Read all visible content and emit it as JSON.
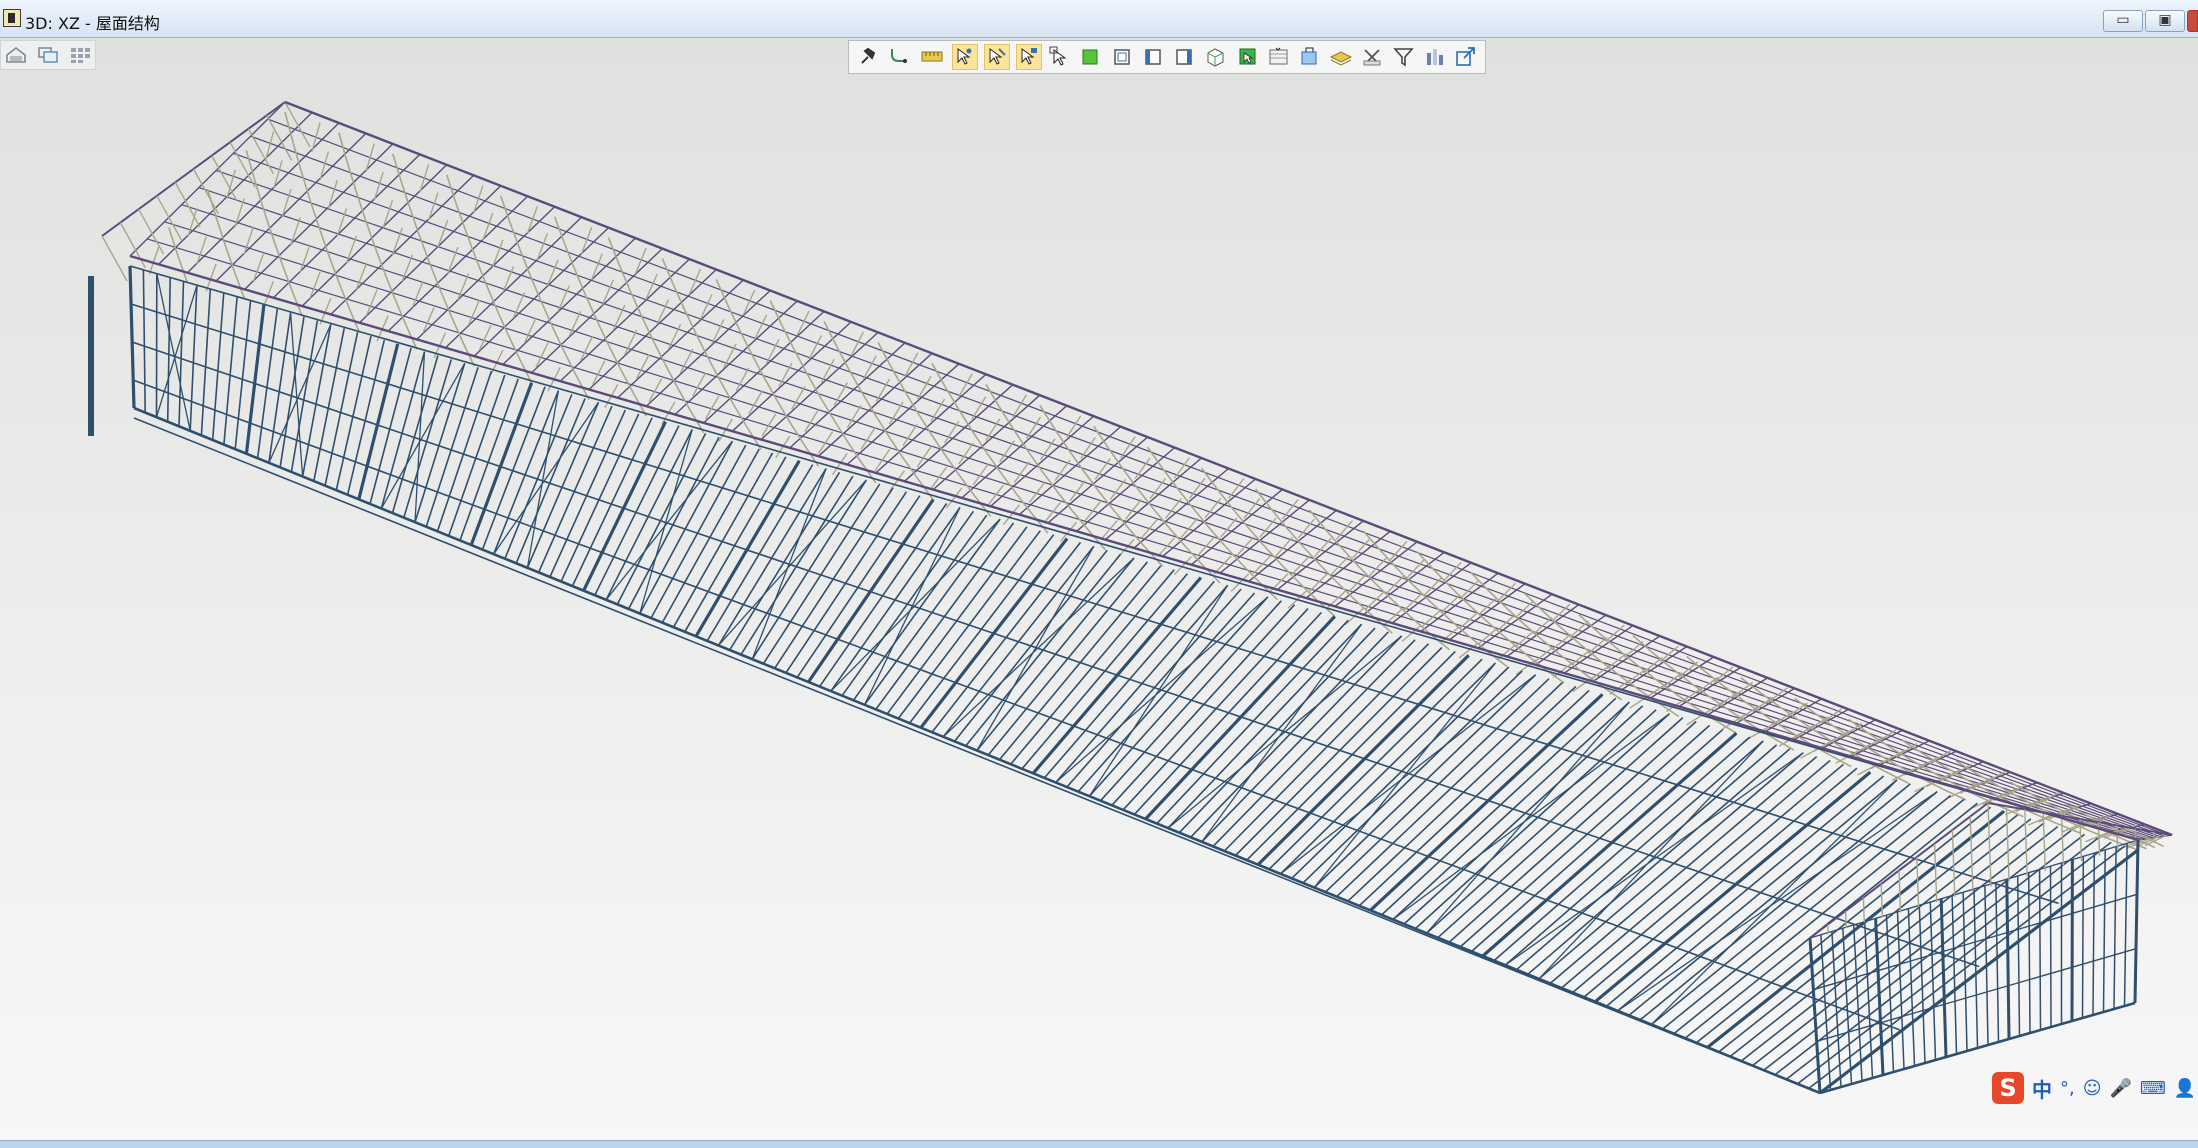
{
  "window": {
    "title": "3D: XZ - 屋面结构",
    "minimize_label": "▭",
    "maximize_label": "▣"
  },
  "view_controls": [
    {
      "name": "home-view-icon"
    },
    {
      "name": "window-stack-icon"
    },
    {
      "name": "grid-tiles-icon"
    }
  ],
  "toolbar": {
    "buttons": [
      {
        "name": "pin-icon",
        "active": false,
        "color": "#333333"
      },
      {
        "name": "snap-curve-icon",
        "active": false,
        "color": "#2e8b57"
      },
      {
        "name": "ruler-icon",
        "active": false,
        "color": "#e8c84a"
      },
      {
        "name": "select-point-icon",
        "active": true,
        "color": "#3a6fb0"
      },
      {
        "name": "select-edge-icon",
        "active": true,
        "color": "#3a6fb0"
      },
      {
        "name": "select-face-icon",
        "active": true,
        "color": "#3a6fb0"
      },
      {
        "name": "select-object-icon",
        "active": false,
        "color": "#333333"
      },
      {
        "name": "solid-box-icon",
        "active": false,
        "color": "#57c43a"
      },
      {
        "name": "box-front-icon",
        "active": false,
        "color": "#3a6fb0"
      },
      {
        "name": "box-left-icon",
        "active": false,
        "color": "#3a6fb0"
      },
      {
        "name": "box-right-icon",
        "active": false,
        "color": "#3a6fb0"
      },
      {
        "name": "box-iso-icon",
        "active": false,
        "color": "#4aa05a"
      },
      {
        "name": "green-cube-icon",
        "active": false,
        "color": "#3bb54a"
      },
      {
        "name": "section-plane-icon",
        "active": false,
        "color": "#666666"
      },
      {
        "name": "clip-icon",
        "active": false,
        "color": "#2a6fb5"
      },
      {
        "name": "layer-highlight-icon",
        "active": false,
        "color": "#e8c84a"
      },
      {
        "name": "eraser-icon",
        "active": false,
        "color": "#555555"
      },
      {
        "name": "filter-icon",
        "active": false,
        "color": "#444444"
      },
      {
        "name": "bars-icon",
        "active": false,
        "color": "#6a7fb0"
      },
      {
        "name": "external-link-icon",
        "active": false,
        "color": "#2a6fb5"
      }
    ]
  },
  "ime": {
    "logo": "S",
    "mode": "中",
    "punct": "°,",
    "emoji": "☺",
    "mic": "🎤",
    "keyboard": "⌨",
    "user": "👤"
  },
  "colors": {
    "frame_steel": "#2f4f6e",
    "truss": "#a8a58a",
    "roof_edge": "#5b4a7a",
    "highlight": "#fce59b"
  }
}
